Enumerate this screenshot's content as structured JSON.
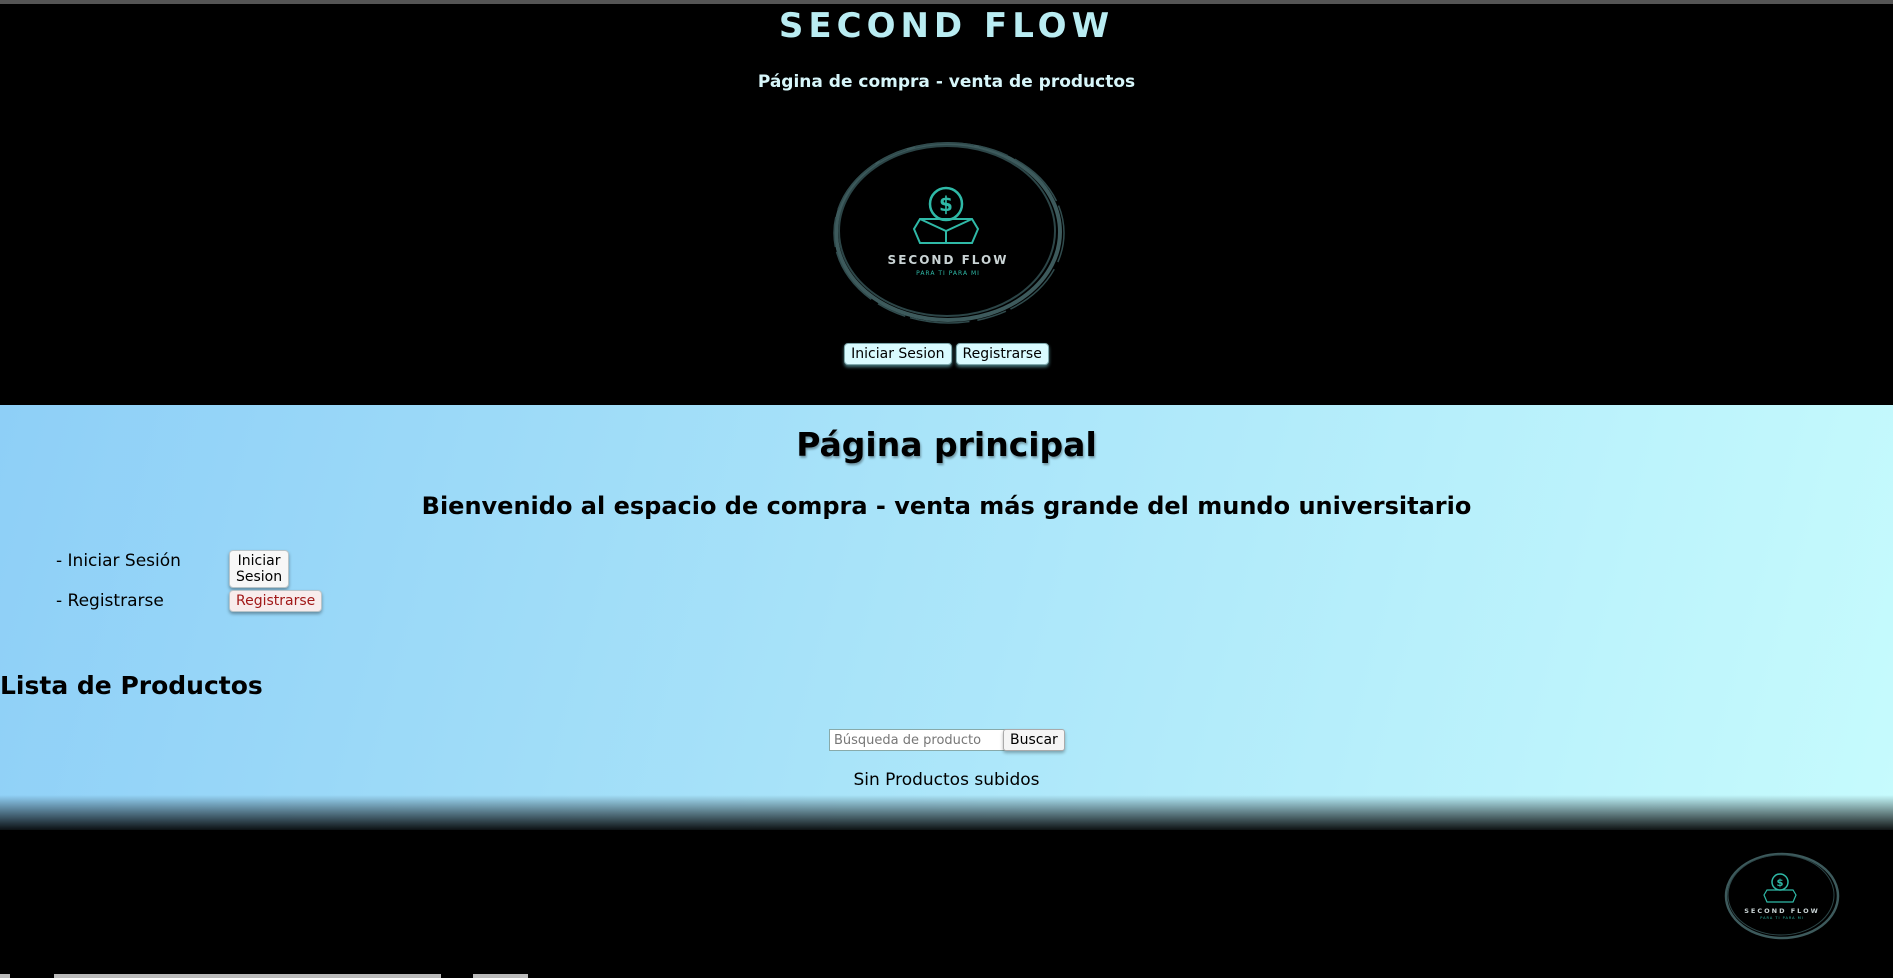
{
  "header": {
    "title": "SECOND FLOW",
    "subtitle": "Página de compra - venta de productos",
    "logo": {
      "word": "SECOND FLOW",
      "tagline": "PARA TI PARA MI"
    },
    "buttons": {
      "login": "Iniciar Sesion",
      "register": "Registrarse"
    }
  },
  "main": {
    "title": "Página principal",
    "welcome": "Bienvenido al espacio de compra - venta más grande del mundo universitario",
    "auth": [
      {
        "label": "- Iniciar Sesión",
        "button": "Iniciar Sesion"
      },
      {
        "label": "- Registrarse",
        "button": "Registrarse"
      }
    ],
    "products": {
      "title": "Lista de Productos",
      "search_placeholder": "Búsqueda de producto",
      "search_button": "Buscar",
      "empty_message": "Sin Productos subidos"
    }
  },
  "footer": {
    "logo": {
      "word": "SECOND FLOW",
      "tagline": "PARA TI PARA MI"
    }
  },
  "colors": {
    "title": "#b9ecf2",
    "logo_accent": "#2fb9a7",
    "ring": "#3d5a5c",
    "gradient_left": "#8ecff7",
    "gradient_right": "#c6fbfd",
    "register_text": "#a11818"
  }
}
